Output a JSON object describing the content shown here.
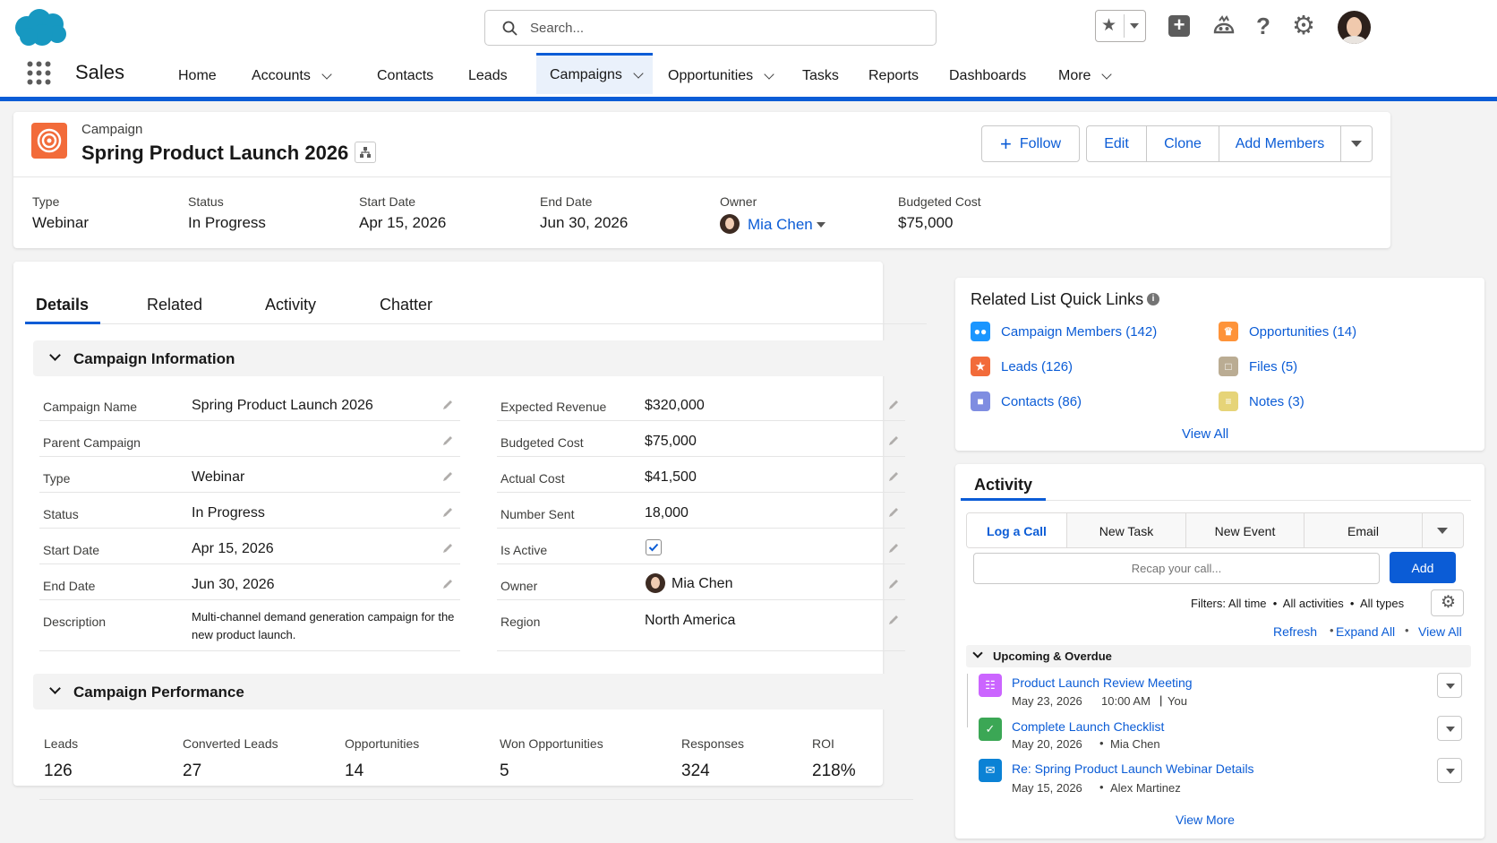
{
  "header": {
    "search_placeholder": "Search..."
  },
  "nav": {
    "app_name": "Sales",
    "items": [
      {
        "label": "Home"
      },
      {
        "label": "Accounts"
      },
      {
        "label": "Contacts"
      },
      {
        "label": "Leads"
      },
      {
        "label": "Campaigns"
      },
      {
        "label": "Opportunities"
      },
      {
        "label": "Tasks"
      },
      {
        "label": "Reports"
      },
      {
        "label": "Dashboards"
      },
      {
        "label": "More"
      }
    ]
  },
  "record": {
    "object_label": "Campaign",
    "title": "Spring Product Launch 2026",
    "actions": {
      "follow": "Follow",
      "edit": "Edit",
      "clone": "Clone",
      "add_members": "Add Members"
    },
    "highlights": [
      {
        "label": "Type",
        "value": "Webinar"
      },
      {
        "label": "Status",
        "value": "In Progress"
      },
      {
        "label": "Start Date",
        "value": "Apr 15, 2026"
      },
      {
        "label": "End Date",
        "value": "Jun 30, 2026"
      },
      {
        "label": "Owner",
        "value": "Mia Chen"
      },
      {
        "label": "Budgeted Cost",
        "value": "$75,000"
      }
    ]
  },
  "tabs": [
    {
      "label": "Details"
    },
    {
      "label": "Related"
    },
    {
      "label": "Activity"
    },
    {
      "label": "Chatter"
    }
  ],
  "campaign_info": {
    "title": "Campaign Information",
    "left": [
      {
        "label": "Campaign Name",
        "value": "Spring Product Launch 2026"
      },
      {
        "label": "Parent Campaign",
        "value": ""
      },
      {
        "label": "Type",
        "value": "Webinar"
      },
      {
        "label": "Status",
        "value": "In Progress"
      },
      {
        "label": "Start Date",
        "value": "Apr 15, 2026"
      },
      {
        "label": "End Date",
        "value": "Jun 30, 2026"
      },
      {
        "label": "Description",
        "value_line1": "Multi-channel demand generation campaign for the",
        "value_line2": "new product launch."
      }
    ],
    "right": [
      {
        "label": "Expected Revenue",
        "value": "$320,000"
      },
      {
        "label": "Budgeted Cost",
        "value": "$75,000"
      },
      {
        "label": "Actual Cost",
        "value": "$41,500"
      },
      {
        "label": "Number Sent",
        "value": "18,000"
      },
      {
        "label": "Is Active",
        "checked": true
      },
      {
        "label": "Owner",
        "value": "Mia Chen"
      },
      {
        "label": "Region",
        "value": "North America"
      }
    ]
  },
  "performance": {
    "title": "Campaign Performance",
    "metrics": [
      {
        "label": "Leads",
        "value": "126"
      },
      {
        "label": "Converted Leads",
        "value": "27"
      },
      {
        "label": "Opportunities",
        "value": "14"
      },
      {
        "label": "Won Opportunities",
        "value": "5"
      },
      {
        "label": "Responses",
        "value": "324"
      },
      {
        "label": "ROI",
        "value": "218%"
      }
    ]
  },
  "quick_links": {
    "title": "Related List Quick Links",
    "items": [
      {
        "label": "Campaign Members (142)",
        "icon": "members-icon",
        "color": "#1b96ff"
      },
      {
        "label": "Opportunities (14)",
        "icon": "opportunity-icon",
        "color": "#fe9339"
      },
      {
        "label": "Leads (126)",
        "icon": "lead-star-icon",
        "color": "#f26b3a"
      },
      {
        "label": "Files (5)",
        "icon": "file-icon",
        "color": "#baac93"
      },
      {
        "label": "Contacts (86)",
        "icon": "contact-card-icon",
        "color": "#7f8de1"
      },
      {
        "label": "Notes (3)",
        "icon": "note-icon",
        "color": "#e6d478"
      }
    ],
    "view_all": "View All"
  },
  "activity": {
    "title": "Activity",
    "tabs": [
      {
        "label": "Log a Call"
      },
      {
        "label": "New Task"
      },
      {
        "label": "New Event"
      },
      {
        "label": "Email"
      }
    ],
    "input_placeholder": "Recap your call...",
    "add_label": "Add",
    "filters_text": "Filters: All time  •  All activities  •  All types",
    "refresh": "Refresh",
    "expand_all": "Expand All",
    "view_all": "View All",
    "group_title": "Upcoming & Overdue",
    "items": [
      {
        "title": "Product Launch Review Meeting",
        "date": "May 23, 2026",
        "time": "10:00 AM",
        "who": "You",
        "icon": "calendar-icon",
        "color": "#cb65ff"
      },
      {
        "title": "Complete Launch Checklist",
        "date": "May 20, 2026",
        "who": "Mia Chen",
        "icon": "task-check-icon",
        "color": "#3ba755"
      },
      {
        "title": "Re: Spring Product Launch Webinar Details",
        "date": "May 15, 2026",
        "who": "Alex Martinez",
        "icon": "email-icon",
        "color": "#0b82d5"
      }
    ],
    "view_more": "View More"
  },
  "colors": {
    "brand_blue": "#0b5cd6",
    "salesforce_cloud": "#1798c1",
    "campaign_orange": "#f26b3a"
  }
}
